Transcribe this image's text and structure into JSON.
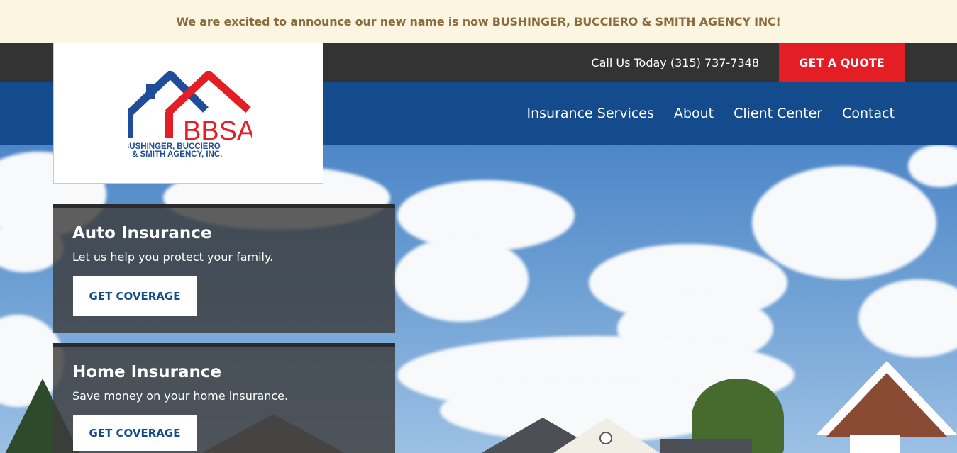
{
  "announcement": "We are excited to announce our new name is now BUSHINGER, BUCCIERO & SMITH AGENCY INC!",
  "header": {
    "call_text": "Call Us Today (315) 737-7348",
    "quote_button": "GET A QUOTE"
  },
  "logo": {
    "abbrev": "BBSA",
    "line1": "BUSHINGER, BUCCIERO",
    "line2": "& SMITH AGENCY, INC."
  },
  "nav": {
    "items": [
      {
        "label": "Insurance Services"
      },
      {
        "label": "About"
      },
      {
        "label": "Client Center"
      },
      {
        "label": "Contact"
      }
    ]
  },
  "cards": [
    {
      "title": "Auto Insurance",
      "subtitle": "Let us help you protect your family.",
      "button": "GET COVERAGE"
    },
    {
      "title": "Home Insurance",
      "subtitle": "Save money on your home insurance.",
      "button": "GET COVERAGE"
    }
  ],
  "colors": {
    "announcement_bg": "#fcf5e2",
    "announcement_text": "#8a6d3b",
    "topbar": "#333333",
    "quote_red": "#e31e24",
    "nav_blue": "#134b8c"
  }
}
